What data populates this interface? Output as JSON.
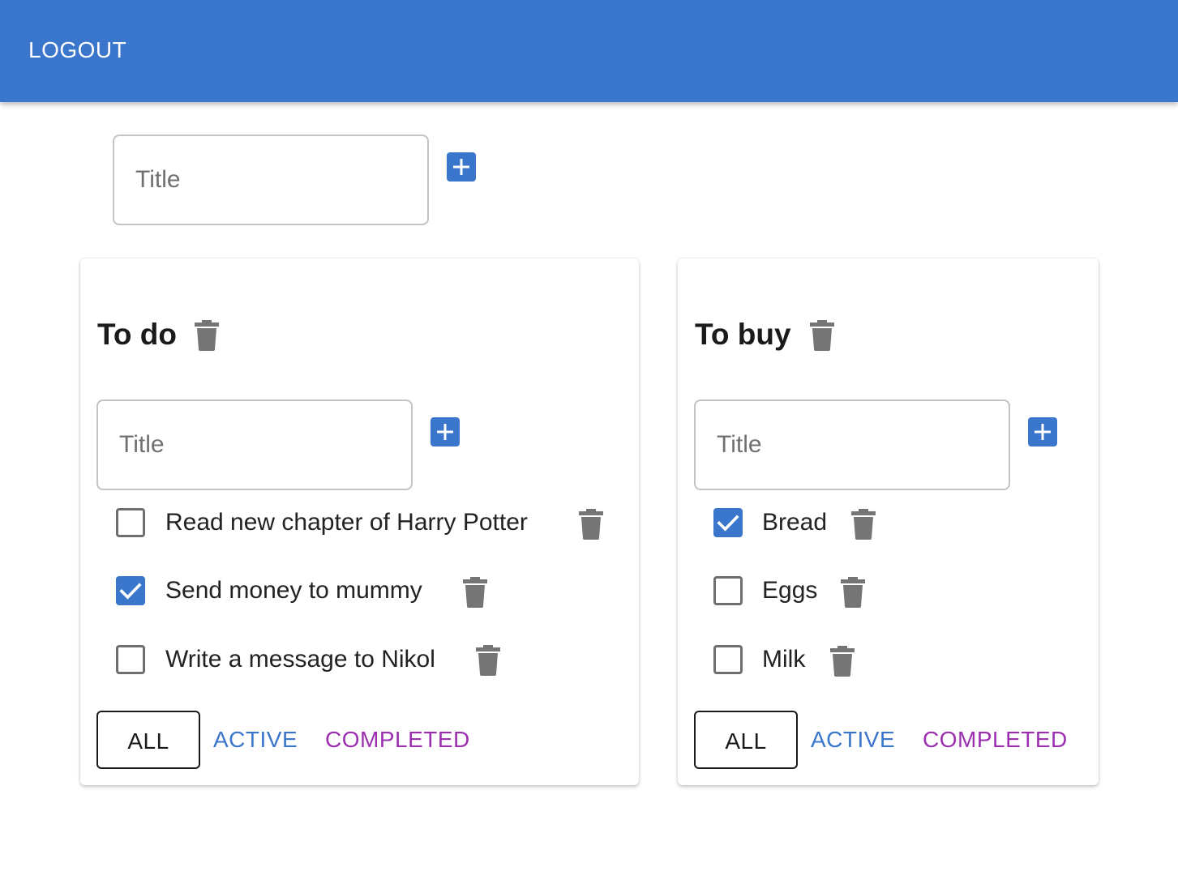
{
  "appbar": {
    "logout_label": "LOGOUT",
    "color": "#3a76cc"
  },
  "new_list": {
    "placeholder": "Title",
    "add_icon": "plus-icon"
  },
  "lists": [
    {
      "title": "To do",
      "input_placeholder": "Title",
      "tasks": [
        {
          "label": "Read new chapter of Harry Potter",
          "done": false
        },
        {
          "label": "Send money to mummy",
          "done": true
        },
        {
          "label": "Write a message to Nikol",
          "done": false
        }
      ],
      "filters": {
        "all": "ALL",
        "active": "ACTIVE",
        "completed": "COMPLETED"
      },
      "selected_filter": "ALL"
    },
    {
      "title": "To buy",
      "input_placeholder": "Title",
      "tasks": [
        {
          "label": "Bread",
          "done": true
        },
        {
          "label": "Eggs",
          "done": false
        },
        {
          "label": "Milk",
          "done": false
        }
      ],
      "filters": {
        "all": "ALL",
        "active": "ACTIVE",
        "completed": "COMPLETED"
      },
      "selected_filter": "ALL"
    }
  ],
  "colors": {
    "primary": "#3a76cc",
    "completed_filter": "#9c2fb0",
    "icon_gray": "#757575"
  },
  "icons": {
    "delete": "trash-icon",
    "add": "plus-icon",
    "checked": "checkmark-icon"
  }
}
